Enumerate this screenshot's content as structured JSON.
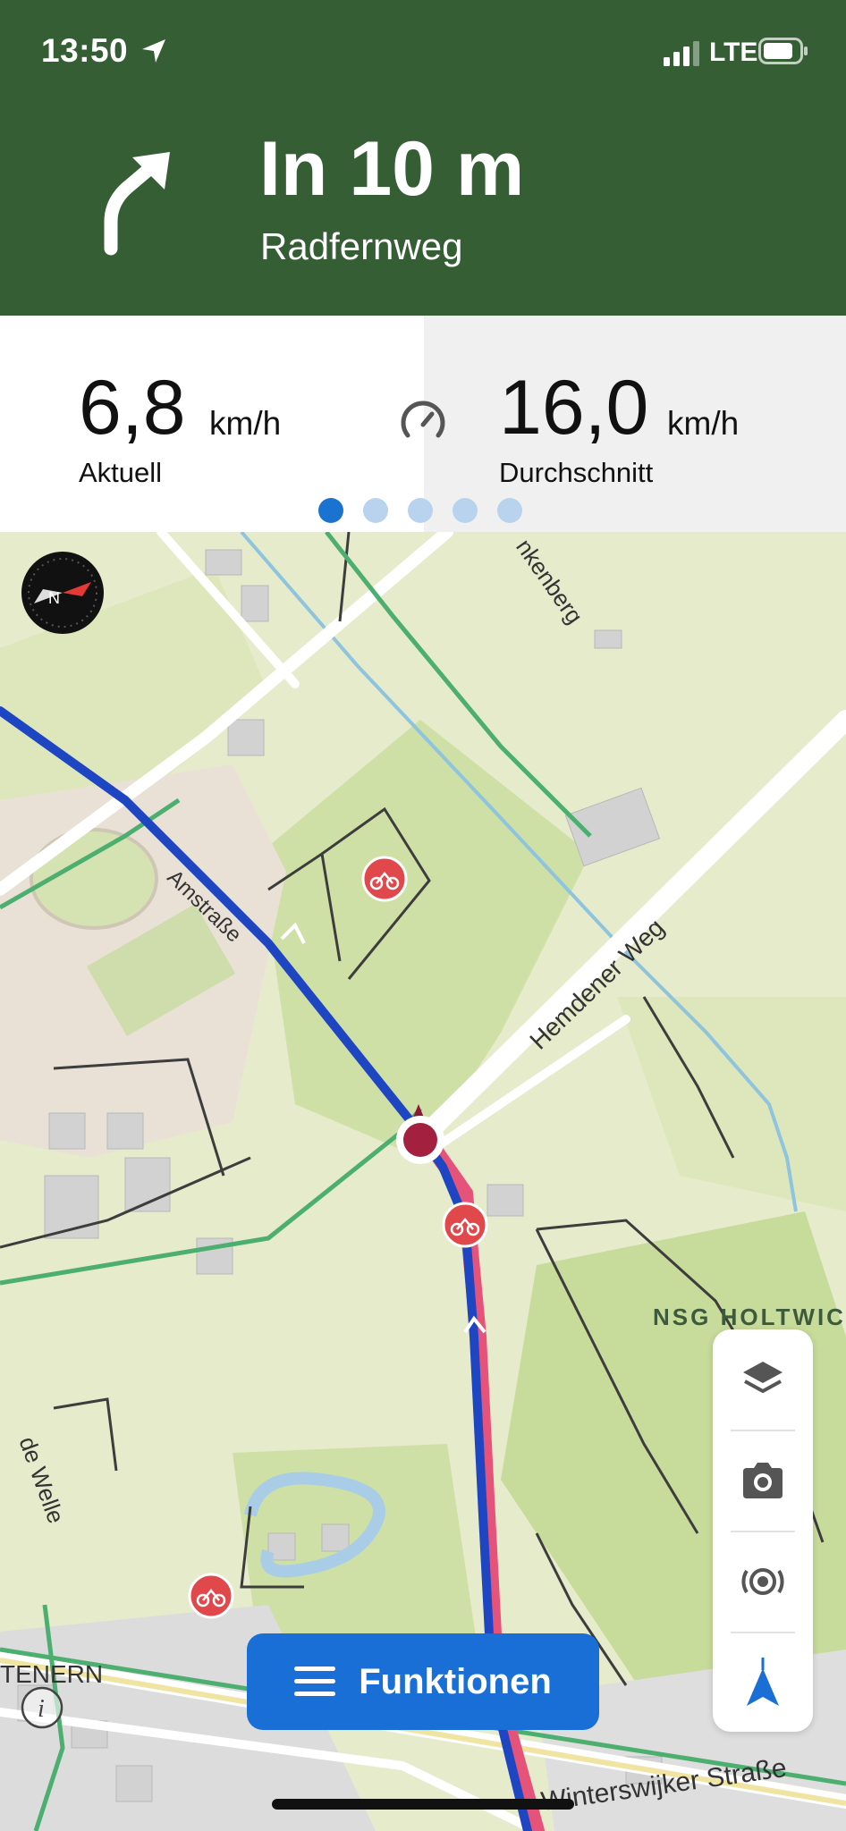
{
  "status_bar": {
    "time": "13:50",
    "network": "LTE"
  },
  "navigation": {
    "distance": "In 10 m",
    "street": "Radfernweg",
    "maneuver_icon": "turn-slight-right-icon"
  },
  "speed_panel": {
    "current": {
      "value": "6,8",
      "unit": "km/h",
      "label": "Aktuell"
    },
    "average": {
      "value": "16,0",
      "unit": "km/h",
      "label": "Durchschnitt"
    },
    "page_dots": {
      "count": 5,
      "active": 0
    }
  },
  "map": {
    "labels": {
      "hemdener_weg": "Hemdener Weg",
      "nsg": "NSG HOLTWICK",
      "winterswijker": "Winterswijker Straße",
      "tenern": "TENERN",
      "welle": "de Welle",
      "kenberg": "nkenberg",
      "amstrasse": "Amstraße"
    }
  },
  "controls": {
    "functions_label": "Funktionen"
  },
  "colors": {
    "header_bg": "#355e34",
    "route_blue": "#1f46c2",
    "route_pink": "#e6537a",
    "accent": "#1a6fd6"
  }
}
